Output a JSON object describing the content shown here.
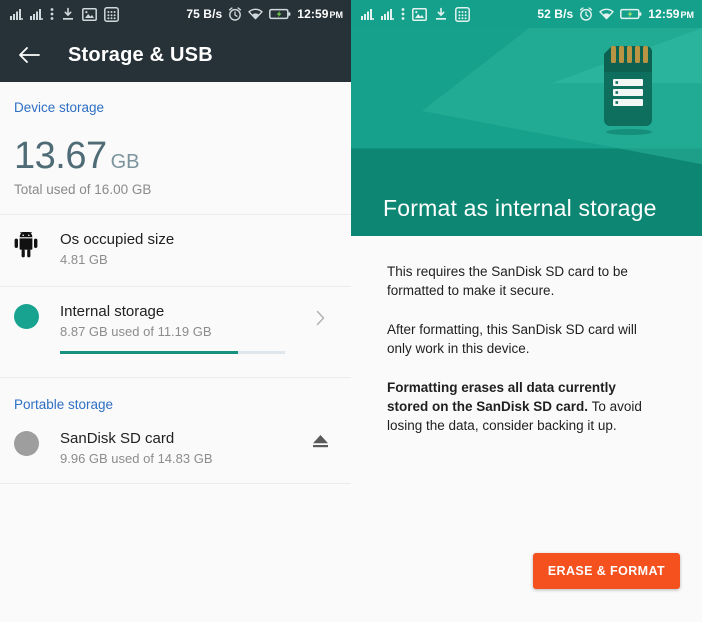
{
  "left": {
    "status_bar": {
      "icons": [
        "signal-bars-sim1-icon",
        "signal-bars-sim2-icon",
        "kebab-menu-icon",
        "download-icon",
        "image-icon",
        "calculator-icon"
      ],
      "network_speed": "75 B/s",
      "right_icons": [
        "alarm-clock-icon",
        "wifi-icon",
        "battery-charging-icon"
      ],
      "time": "12:59",
      "ampm": "PM",
      "background": "#263238"
    },
    "appbar": {
      "back_icon": "arrow-back-icon",
      "title": "Storage & USB",
      "background": "#263238"
    },
    "device_section": {
      "header": "Device storage",
      "total_value": "13.67",
      "total_unit": "GB",
      "total_sub": "Total used of 16.00 GB"
    },
    "items": [
      {
        "icon": "android-robot-icon",
        "title": "Os occupied size",
        "subtitle": "4.81 GB",
        "accessory": "none"
      },
      {
        "icon": "storage-dot-teal-icon",
        "title": "Internal storage",
        "subtitle": "8.87 GB used of 11.19 GB",
        "accessory": "chevron-right-icon",
        "progress_percent": 79
      }
    ],
    "portable_section": {
      "header": "Portable storage",
      "item": {
        "icon": "storage-dot-gray-icon",
        "title": "SanDisk SD card",
        "subtitle": "9.96 GB used of 14.83 GB",
        "accessory": "eject-icon"
      }
    },
    "colors": {
      "accent_blue": "#2e6fc4",
      "teal": "#18a391",
      "background": "#fafafa"
    }
  },
  "right": {
    "status_bar": {
      "icons": [
        "signal-bars-sim1-icon",
        "signal-bars-sim2-icon",
        "kebab-menu-icon",
        "image-icon",
        "download-icon",
        "calculator-icon"
      ],
      "network_speed": "52 B/s",
      "right_icons": [
        "alarm-clock-icon",
        "wifi-icon",
        "battery-icon"
      ],
      "time": "12:59",
      "ampm": "PM",
      "background": "#14a08a"
    },
    "hero": {
      "title": "Format as internal storage",
      "illustration": "sd-card-icon",
      "background": "#15a18b"
    },
    "paragraphs": [
      {
        "bold": "",
        "text": "This requires the SanDisk SD card to be formatted to make it secure."
      },
      {
        "bold": "",
        "text": "After formatting, this SanDisk SD card will only work in this device."
      },
      {
        "bold": "Formatting erases all data currently stored on the SanDisk SD card.",
        "text": " To avoid losing the data, consider backing it up."
      }
    ],
    "button": {
      "label": "ERASE & FORMAT",
      "color": "#f4511e"
    }
  }
}
